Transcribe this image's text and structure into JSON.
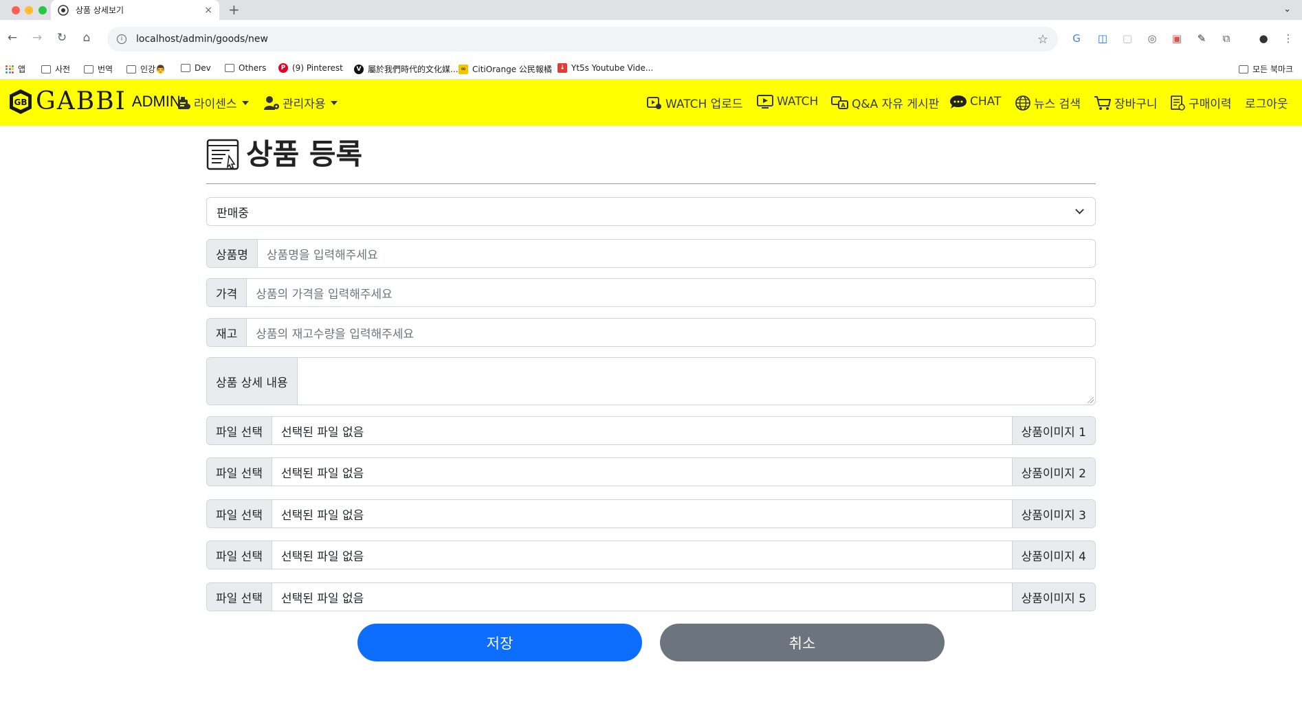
{
  "browser": {
    "tab_title": "상품 상세보기",
    "tab_close": "×",
    "new_tab": "+",
    "tab_menu": "⌄",
    "url": "localhost/admin/goods/new",
    "bookmarks": [
      {
        "label": "앱",
        "icon": "apps-grid-icon"
      },
      {
        "label": "사전",
        "icon": "folder-icon"
      },
      {
        "label": "번역",
        "icon": "folder-icon"
      },
      {
        "label": "인강👨",
        "icon": "folder-icon"
      },
      {
        "label": "Dev",
        "icon": "folder-icon"
      },
      {
        "label": "Others",
        "icon": "folder-icon"
      },
      {
        "label": "(9) Pinterest",
        "icon": "pinterest-icon"
      },
      {
        "label": "屬於我們時代的文化媒...",
        "icon": "v-logo-icon"
      },
      {
        "label": "CitiOrange 公民報橘",
        "icon": "citiorange-icon"
      },
      {
        "label": "Yt5s Youtube Vide...",
        "icon": "yt5s-icon"
      }
    ],
    "all_bookmarks": "모든 북마크"
  },
  "navbar": {
    "brand": "GABBI",
    "admin": "ADMIN",
    "left_menu": [
      {
        "label": "라이센스",
        "icon": "license-icon"
      },
      {
        "label": "관리자용",
        "icon": "admin-user-icon"
      }
    ],
    "right_menu": [
      {
        "label": "WATCH 업로드",
        "icon": "video-upload-icon"
      },
      {
        "label": "WATCH",
        "icon": "video-play-icon"
      },
      {
        "label": "Q&A 자유 게시판",
        "icon": "qa-board-icon"
      },
      {
        "label": "CHAT",
        "icon": "chat-icon"
      },
      {
        "label": "뉴스 검색",
        "icon": "globe-icon"
      },
      {
        "label": "장바구니",
        "icon": "cart-icon"
      },
      {
        "label": "구매이력",
        "icon": "receipt-icon"
      },
      {
        "label": "로그아웃",
        "icon": ""
      }
    ]
  },
  "page": {
    "title": "상품 등록",
    "status_select": "판매중",
    "name": {
      "label": "상품명",
      "placeholder": "상품명을 입력해주세요"
    },
    "price": {
      "label": "가격",
      "placeholder": "상품의 가격을 입력해주세요"
    },
    "stock": {
      "label": "재고",
      "placeholder": "상품의 재고수량을 입력해주세요"
    },
    "detail": {
      "label": "상품 상세 내용",
      "value": ""
    },
    "files": [
      {
        "button": "파일 선택",
        "value": "선택된 파일 없음",
        "label": "상품이미지 1"
      },
      {
        "button": "파일 선택",
        "value": "선택된 파일 없음",
        "label": "상품이미지 2"
      },
      {
        "button": "파일 선택",
        "value": "선택된 파일 없음",
        "label": "상품이미지 3"
      },
      {
        "button": "파일 선택",
        "value": "선택된 파일 없음",
        "label": "상품이미지 4"
      },
      {
        "button": "파일 선택",
        "value": "선택된 파일 없음",
        "label": "상품이미지 5"
      }
    ],
    "save_button": "저장",
    "cancel_button": "취소"
  },
  "colors": {
    "navbar_bg": "#ffff00",
    "primary": "#0d6efd",
    "secondary": "#6c757d"
  }
}
